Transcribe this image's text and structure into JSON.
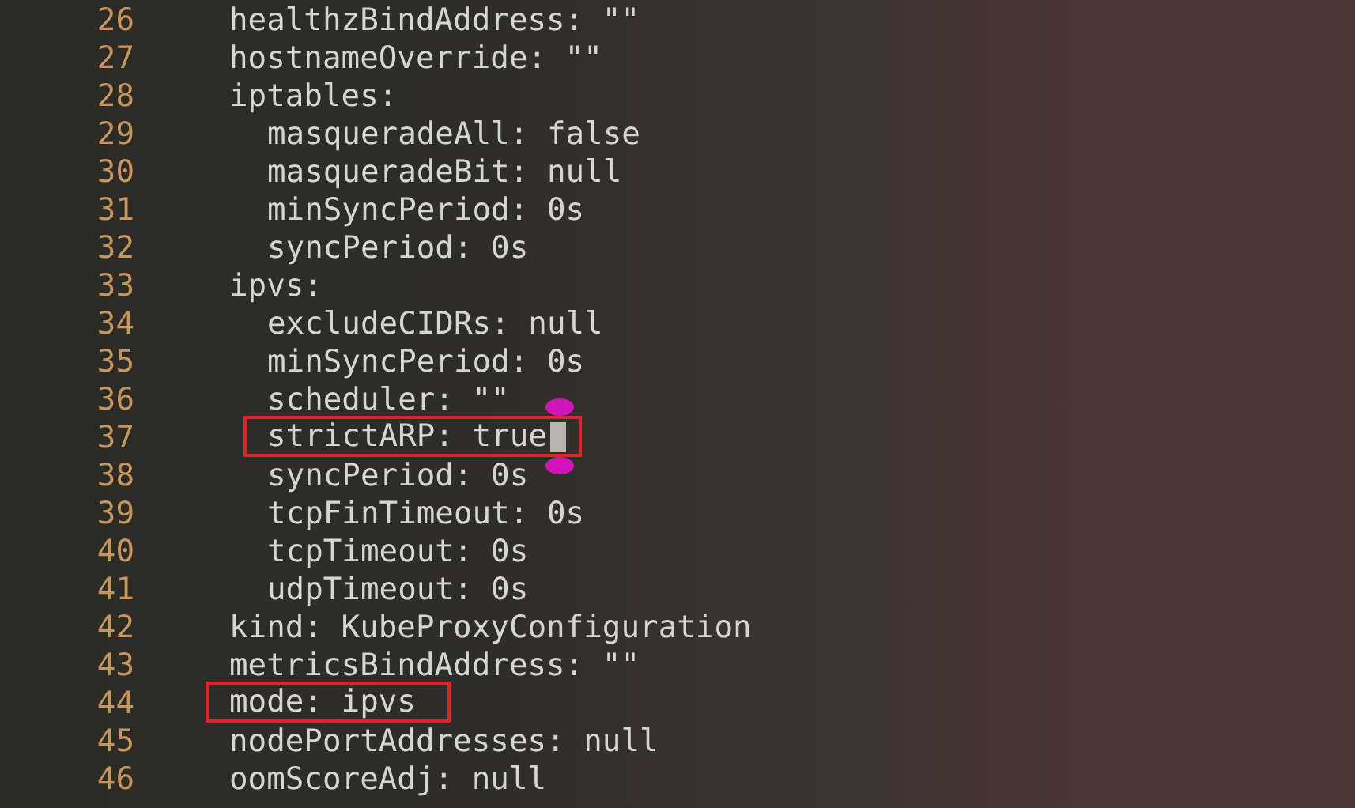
{
  "lines": [
    {
      "number": "26",
      "text": "healthzBindAddress: \"\"",
      "highlighted": false,
      "cursor": false
    },
    {
      "number": "27",
      "text": "hostnameOverride: \"\"",
      "highlighted": false,
      "cursor": false
    },
    {
      "number": "28",
      "text": "iptables:",
      "highlighted": false,
      "cursor": false,
      "children": [
        {
          "number": "29",
          "text": "masqueradeAll: false",
          "highlighted": false,
          "cursor": false
        },
        {
          "number": "30",
          "text": "masqueradeBit: null",
          "highlighted": false,
          "cursor": false
        },
        {
          "number": "31",
          "text": "minSyncPeriod: 0s",
          "highlighted": false,
          "cursor": false
        },
        {
          "number": "32",
          "text": "syncPeriod: 0s",
          "highlighted": false,
          "cursor": false
        }
      ]
    },
    {
      "number": "33",
      "text": "ipvs:",
      "highlighted": false,
      "cursor": false,
      "children": [
        {
          "number": "34",
          "text": "excludeCIDRs: null",
          "highlighted": false,
          "cursor": false
        },
        {
          "number": "35",
          "text": "minSyncPeriod: 0s",
          "highlighted": false,
          "cursor": false
        },
        {
          "number": "36",
          "text": "scheduler: \"\"",
          "highlighted": false,
          "cursor": false
        },
        {
          "number": "37",
          "text": "strictARP: true",
          "highlighted": true,
          "cursor": true
        },
        {
          "number": "38",
          "text": "syncPeriod: 0s",
          "highlighted": false,
          "cursor": false
        },
        {
          "number": "39",
          "text": "tcpFinTimeout: 0s",
          "highlighted": false,
          "cursor": false
        },
        {
          "number": "40",
          "text": "tcpTimeout: 0s",
          "highlighted": false,
          "cursor": false
        },
        {
          "number": "41",
          "text": "udpTimeout: 0s",
          "highlighted": false,
          "cursor": false
        }
      ]
    },
    {
      "number": "42",
      "text": "kind: KubeProxyConfiguration",
      "highlighted": false,
      "cursor": false
    },
    {
      "number": "43",
      "text": "metricsBindAddress: \"\"",
      "highlighted": false,
      "cursor": false
    },
    {
      "number": "44",
      "text": "mode: ipvs",
      "highlighted": true,
      "cursor": false
    },
    {
      "number": "45",
      "text": "nodePortAddresses: null",
      "highlighted": false,
      "cursor": false
    },
    {
      "number": "46",
      "text": "oomScoreAdj: null",
      "highlighted": false,
      "cursor": false
    }
  ]
}
